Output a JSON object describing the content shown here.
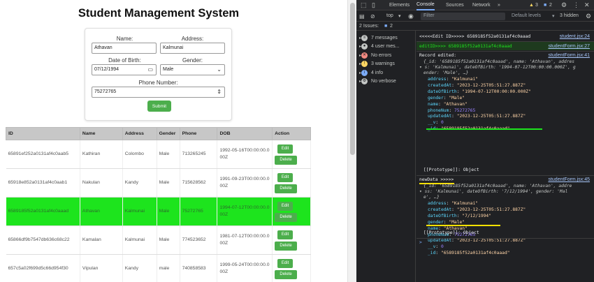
{
  "app": {
    "title": "Student Management System"
  },
  "form": {
    "name_label": "Name:",
    "name_value": "Athavan",
    "address_label": "Address:",
    "address_value": "Kalmunai",
    "dob_label": "Date of Birth:",
    "dob_value": "07/12/1994",
    "gender_label": "Gender:",
    "gender_value": "Male",
    "phone_label": "Phone Number:",
    "phone_value": "75272765",
    "submit_label": "Submit"
  },
  "table": {
    "headers": [
      "ID",
      "Name",
      "Address",
      "Gender",
      "Phone",
      "DOB",
      "Action"
    ],
    "edit_label": "Edit",
    "delete_label": "Delete",
    "rows": [
      {
        "id": "65891ef252a0131af4c0aab5",
        "name": "Kathiran",
        "address": "Colombo",
        "gender": "Male",
        "phone": "713265245",
        "dob": "1992-05-16T00:00:00.000Z"
      },
      {
        "id": "65918e852a0131af4c0aab1",
        "name": "Nakulan",
        "address": "Kandy",
        "gender": "Male",
        "phone": "715628562",
        "dob": "1991-09-23T00:00:00.000Z"
      },
      {
        "id": "6589185f52a0131af4c0aaad",
        "name": "Athavan",
        "address": "Kalmunai",
        "gender": "Male",
        "phone": "75272765",
        "dob": "1994-07-12T00:00:00.000Z"
      },
      {
        "id": "65866df9b7547db636c68c22",
        "name": "Kamalan",
        "address": "Kalmunai",
        "gender": "Male",
        "phone": "774523652",
        "dob": "1981-07-12T00:00:00.000Z"
      },
      {
        "id": "657c5a02f699d5c66d954f30",
        "name": "Vipulan",
        "address": "Kandy",
        "gender": "male",
        "phone": "740858583",
        "dob": "1999-05-24T00:00:00.000Z"
      }
    ]
  },
  "devtools": {
    "tabs": [
      "Elements",
      "Console",
      "Sources",
      "Network"
    ],
    "more": "»",
    "warnings_count": "3",
    "errors_count": "2",
    "context": "top",
    "filter_placeholder": "Filter",
    "levels": "Default levels",
    "hidden": "3 hidden",
    "issues": "2 Issues:",
    "issues_count": "2",
    "sidebar": [
      {
        "label": "7 messages",
        "icon": "list-icon"
      },
      {
        "label": "4 user mes...",
        "icon": "user-icon"
      },
      {
        "label": "No errors",
        "icon": "error-icon"
      },
      {
        "label": "3 warnings",
        "icon": "warning-icon"
      },
      {
        "label": "4 info",
        "icon": "info-icon"
      },
      {
        "label": "No verbose",
        "icon": "verbose-icon"
      }
    ],
    "log1": {
      "text": "<<<<<Edit ID>>>>> 6589185f52a0131af4c0aaad",
      "src": "student.jsx:24"
    },
    "log2": {
      "text": "editID>>>> 6589185f52a0131af4c0aaad",
      "src": "studentForm.jsx:27"
    },
    "log3": {
      "text": "Record edited:",
      "src": "studentForm.jsx:41"
    },
    "rec_line1": "{_id: '6589185f52a0131af4c0aaad', name: 'Athavan', addres",
    "rec_line2": "s: 'Kalmunai', dateOfBirth: '1994-07-12T00:00:00.000Z', g",
    "rec_line3": "ender: 'Male', …}",
    "rec_props": [
      {
        "k": "address",
        "v": "\"Kalmunai\""
      },
      {
        "k": "createdAt",
        "v": "\"2023-12-25T05:51:27.887Z\""
      },
      {
        "k": "dateOfBirth",
        "v": "\"1994-07-12T00:00:00.000Z\""
      },
      {
        "k": "gender",
        "v": "\"Male\""
      },
      {
        "k": "name",
        "v": "\"Athavan\""
      },
      {
        "k": "phoneNum",
        "v": "75272765"
      },
      {
        "k": "updatedAt",
        "v": "\"2023-12-25T05:51:27.887Z\""
      },
      {
        "k": "__v",
        "v": "0"
      },
      {
        "k": "_id",
        "v": "\"6589185f52a0131af4c0aaad\""
      }
    ],
    "proto": "[[Prototype]]: Object",
    "log4": {
      "text": "newData >>>>>",
      "src": "studentForm.jsx:45"
    },
    "new_line1": "{_id: '6589185f52a0131af4c0aaad', name: 'Athavan', addre",
    "new_line2": "ss: 'Kalmunai', dateOfBirth: '7/12/1994', gender: 'Mal",
    "new_line3": "e', …}",
    "new_props": [
      {
        "k": "address",
        "v": "\"Kalmunai\""
      },
      {
        "k": "createdAt",
        "v": "\"2023-12-25T05:51:27.887Z\""
      },
      {
        "k": "dateOfBirth",
        "v": "\"7/12/1994\""
      },
      {
        "k": "gender",
        "v": "\"Male\""
      },
      {
        "k": "name",
        "v": "\"Athavan\""
      },
      {
        "k": "phoneNum",
        "v": "75272765"
      },
      {
        "k": "updatedAt",
        "v": "\"2023-12-25T05:51:27.887Z\""
      },
      {
        "k": "__v",
        "v": "0"
      },
      {
        "k": "_id",
        "v": "\"6589185f52a0131af4c0aaad\""
      }
    ],
    "prompt": ">"
  }
}
